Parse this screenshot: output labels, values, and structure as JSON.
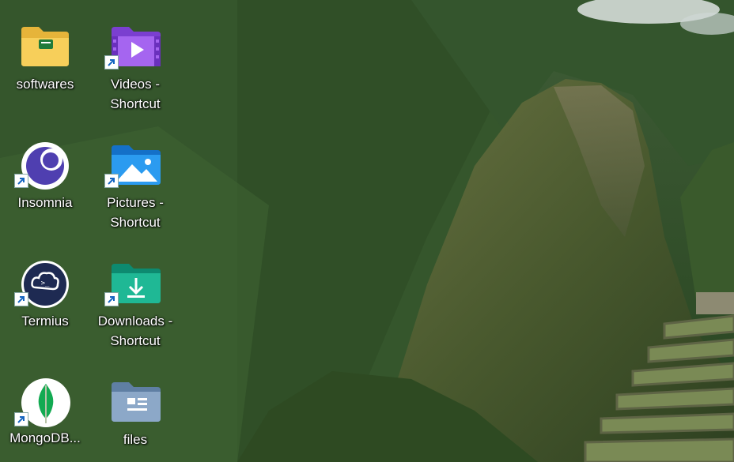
{
  "desktop": {
    "icons": [
      {
        "label": "softwares",
        "icon": "folder-icon",
        "shortcut": false
      },
      {
        "label": "Videos -\nShortcut",
        "icon": "videos-folder-icon",
        "shortcut": true
      },
      {
        "label": "Insomnia",
        "icon": "insomnia-app-icon",
        "shortcut": true
      },
      {
        "label": "Pictures -\nShortcut",
        "icon": "pictures-folder-icon",
        "shortcut": true
      },
      {
        "label": "Termius",
        "icon": "termius-app-icon",
        "shortcut": true
      },
      {
        "label": "Downloads -\nShortcut",
        "icon": "downloads-folder-icon",
        "shortcut": true
      },
      {
        "label": "MongoDB...",
        "icon": "mongodb-app-icon",
        "shortcut": true
      },
      {
        "label": "files",
        "icon": "files-folder-icon",
        "shortcut": false
      }
    ]
  },
  "colors": {
    "folder_yellow": "#f5c84b",
    "videos_purple": "#9b5de5",
    "pictures_blue": "#1e90e6",
    "downloads_teal": "#18a88c",
    "files_grey": "#7f9ab8",
    "insomnia_purple": "#4f3fb0",
    "termius_navy": "#1e2a52",
    "mongodb_green": "#13aa52"
  }
}
